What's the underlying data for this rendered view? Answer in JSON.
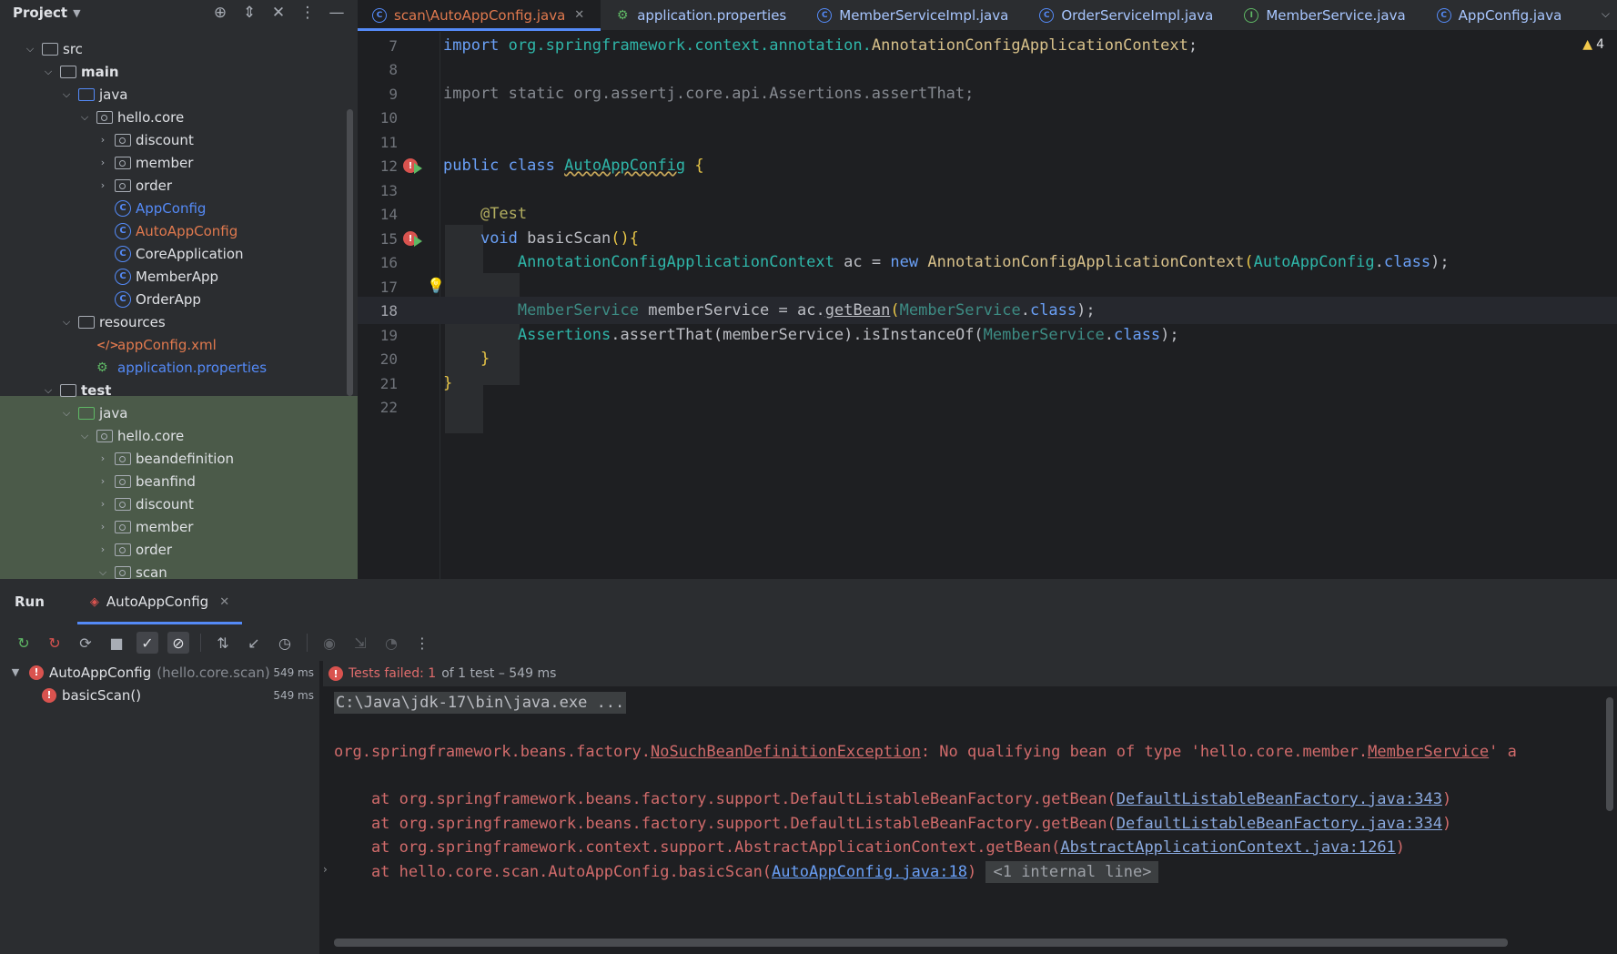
{
  "project": {
    "title": "Project",
    "tree": [
      {
        "label": "src",
        "depth": 1,
        "arrow": "open",
        "icon": "folder"
      },
      {
        "label": "main",
        "depth": 2,
        "arrow": "open",
        "icon": "folder",
        "bold": true
      },
      {
        "label": "java",
        "depth": 3,
        "arrow": "open",
        "icon": "folder-blue"
      },
      {
        "label": "hello.core",
        "depth": 4,
        "arrow": "open",
        "icon": "package"
      },
      {
        "label": "discount",
        "depth": 5,
        "arrow": "closed",
        "icon": "package"
      },
      {
        "label": "member",
        "depth": 5,
        "arrow": "closed",
        "icon": "package"
      },
      {
        "label": "order",
        "depth": 5,
        "arrow": "closed",
        "icon": "package"
      },
      {
        "label": "AppConfig",
        "depth": 5,
        "arrow": "none",
        "icon": "class",
        "color": "blue"
      },
      {
        "label": "AutoAppConfig",
        "depth": 5,
        "arrow": "none",
        "icon": "class",
        "color": "red"
      },
      {
        "label": "CoreApplication",
        "depth": 5,
        "arrow": "none",
        "icon": "class"
      },
      {
        "label": "MemberApp",
        "depth": 5,
        "arrow": "none",
        "icon": "class"
      },
      {
        "label": "OrderApp",
        "depth": 5,
        "arrow": "none",
        "icon": "class"
      },
      {
        "label": "resources",
        "depth": 3,
        "arrow": "open",
        "icon": "folder"
      },
      {
        "label": "appConfig.xml",
        "depth": 4,
        "arrow": "none",
        "icon": "xml",
        "color": "red"
      },
      {
        "label": "application.properties",
        "depth": 4,
        "arrow": "none",
        "icon": "properties",
        "color": "blue"
      },
      {
        "label": "test",
        "depth": 2,
        "arrow": "open",
        "icon": "folder",
        "bold": true
      },
      {
        "label": "java",
        "depth": 3,
        "arrow": "open",
        "icon": "folder-green"
      },
      {
        "label": "hello.core",
        "depth": 4,
        "arrow": "open",
        "icon": "package"
      },
      {
        "label": "beandefinition",
        "depth": 5,
        "arrow": "closed",
        "icon": "package"
      },
      {
        "label": "beanfind",
        "depth": 5,
        "arrow": "closed",
        "icon": "package"
      },
      {
        "label": "discount",
        "depth": 5,
        "arrow": "closed",
        "icon": "package"
      },
      {
        "label": "member",
        "depth": 5,
        "arrow": "closed",
        "icon": "package"
      },
      {
        "label": "order",
        "depth": 5,
        "arrow": "closed",
        "icon": "package"
      },
      {
        "label": "scan",
        "depth": 5,
        "arrow": "open",
        "icon": "package"
      }
    ]
  },
  "editor": {
    "tabs": [
      {
        "label": "scan\\AutoAppConfig.java",
        "icon": "class-icon",
        "active": true
      },
      {
        "label": "application.properties",
        "icon": "properties-icon"
      },
      {
        "label": "MemberServiceImpl.java",
        "icon": "class-icon"
      },
      {
        "label": "OrderServiceImpl.java",
        "icon": "class-icon"
      },
      {
        "label": "MemberService.java",
        "icon": "interface-icon"
      },
      {
        "label": "AppConfig.java",
        "icon": "class-icon"
      }
    ],
    "warnings": "4",
    "lines": [
      {
        "n": "7"
      },
      {
        "n": "8"
      },
      {
        "n": "9"
      },
      {
        "n": "10"
      },
      {
        "n": "11"
      },
      {
        "n": "12"
      },
      {
        "n": "13"
      },
      {
        "n": "14"
      },
      {
        "n": "15"
      },
      {
        "n": "16"
      },
      {
        "n": "17"
      },
      {
        "n": "18"
      },
      {
        "n": "19"
      },
      {
        "n": "20"
      },
      {
        "n": "21"
      },
      {
        "n": "22"
      }
    ],
    "code": {
      "l7_kw": "import",
      "l7_pkg": "org.springframework.context.annotation.",
      "l7_cls": "AnnotationConfigApplicationContext",
      "l7_end": ";",
      "l9": "import static org.assertj.core.api.Assertions.assertThat;",
      "l12_kw1": "public",
      "l12_kw2": "class",
      "l12_cls": "AutoAppConfig",
      "l12_brace": "{",
      "l14": "@Test",
      "l15_kw": "void",
      "l15_name": "basicScan",
      "l15_rest": "(){",
      "l16_type": "AnnotationConfigApplicationContext",
      "l16_var": "ac",
      "l16_eq": "=",
      "l16_new": "new",
      "l16_ctor": "AnnotationConfigApplicationContext",
      "l16_arg": "AutoAppConfig",
      "l16_dot": ".",
      "l16_class": "class",
      "l16_end": ");",
      "l18_type": "MemberService",
      "l18_var": "memberService",
      "l18_eq": "=",
      "l18_ac": "ac.",
      "l18_method": "getBean",
      "l18_arg": "MemberService",
      "l18_dot": ".",
      "l18_class": "class",
      "l18_end": ");",
      "l19_a": "Assertions",
      "l19_b": ".assertThat(",
      "l19_var": "memberService",
      "l19_c": ").isInstanceOf(",
      "l19_arg": "MemberService",
      "l19_dot": ".",
      "l19_class": "class",
      "l19_end": ");",
      "l20": "}",
      "l21": "}"
    }
  },
  "run": {
    "title": "Run",
    "tab_label": "AutoAppConfig",
    "tests": [
      {
        "name": "AutoAppConfig",
        "pkg": "(hello.core.scan)",
        "time": "549 ms"
      },
      {
        "name": "basicScan()",
        "time": "549 ms"
      }
    ],
    "status_failed": "Tests failed: 1",
    "status_rest": "of 1 test – 549 ms",
    "console": {
      "cmd": "C:\\Java\\jdk-17\\bin\\java.exe ...",
      "err_prefix": "org.springframework.beans.factory.",
      "err_class": "NoSuchBeanDefinitionException",
      "err_msg": ": No qualifying bean of type 'hello.core.member.",
      "err_type": "MemberService",
      "err_tail": "' a",
      "st1_pre": "    at org.springframework.beans.factory.support.DefaultListableBeanFactory.getBean(",
      "st1_link": "DefaultListableBeanFactory.java:343",
      "st2_pre": "    at org.springframework.beans.factory.support.DefaultListableBeanFactory.getBean(",
      "st2_link": "DefaultListableBeanFactory.java:334",
      "st3_pre": "    at org.springframework.context.support.AbstractApplicationContext.getBean(",
      "st3_link": "AbstractApplicationContext.java:1261",
      "st4_pre": "    at hello.core.scan.AutoAppConfig.basicScan(",
      "st4_link": "AutoAppConfig.java:18",
      "st4_ghost": "<1 internal line>",
      "close_paren": ")"
    }
  }
}
